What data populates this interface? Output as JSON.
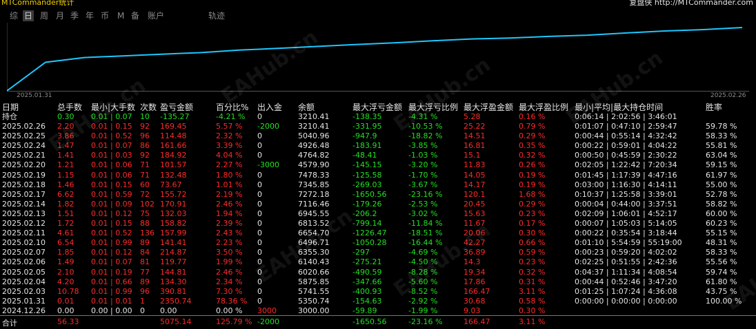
{
  "window": {
    "title": "MTCommander统计",
    "brand_cn": "复盘侠",
    "brand_url": "http://MTCommander.com"
  },
  "tabs": [
    "综",
    "日",
    "周",
    "月",
    "季",
    "年",
    "币",
    "M",
    "备",
    "账户",
    "轨迹"
  ],
  "active_tab": "日",
  "chart": {
    "start_label": "2025.01.31",
    "end_label": "2025.02.26",
    "line_color": "#1ec8ff"
  },
  "chart_data": {
    "type": "line",
    "x": [
      "2024.12.26",
      "2025.01.31",
      "2025.02.03",
      "2025.02.04",
      "2025.02.05",
      "2025.02.06",
      "2025.02.07",
      "2025.02.10",
      "2025.02.11",
      "2025.02.12",
      "2025.02.13",
      "2025.02.14",
      "2025.02.17",
      "2025.02.18",
      "2025.02.19",
      "2025.02.20",
      "2025.02.21",
      "2025.02.24",
      "2025.02.25",
      "2025.02.26"
    ],
    "values": [
      3000.0,
      5350.74,
      5741.55,
      5875.85,
      6020.66,
      6140.43,
      6355.3,
      6496.71,
      6654.7,
      6813.52,
      6945.55,
      7116.46,
      7272.18,
      7345.85,
      7478.33,
      4579.9,
      4764.82,
      4926.48,
      5040.96,
      3210.41
    ],
    "title": "",
    "xlabel": "",
    "ylabel": ""
  },
  "table": {
    "headers": [
      "日期",
      "总手数",
      "最小|大手数",
      "次数",
      "盈亏金额",
      "百分比%",
      "出入金",
      "余额",
      "最大浮亏金额",
      "最大浮亏比例",
      "最大浮盈金额",
      "最大浮盈比例",
      "最小|平均|最大持仓时间",
      "胜率"
    ],
    "position_row": [
      "持仓",
      "0.30",
      "0.01 | 0.07",
      "10",
      "-135.27",
      "-4.21 %",
      "0",
      "3210.41",
      "-138.35",
      "-4.31 %",
      "5.28",
      "0.16 %",
      "0:06:14 | 2:02:56 | 3:46:01",
      ""
    ],
    "rows": [
      [
        "2025.02.26",
        "2.20",
        "0.01 | 0.15",
        "92",
        "169.45",
        "5.57 %",
        "-2000",
        "3210.41",
        "-331.95",
        "-10.53 %",
        "25.22",
        "0.79 %",
        "0:01:07 | 0:47:10 | 2:59:47",
        "59.78 %"
      ],
      [
        "2025.02.25",
        "3.86",
        "0.01 | 0.52",
        "96",
        "114.48",
        "2.32 %",
        "0",
        "5040.96",
        "-947.9",
        "-18.82 %",
        "14.51",
        "0.29 %",
        "0:00:44 | 0:55:14 | 4:32:42",
        "58.33 %"
      ],
      [
        "2025.02.24",
        "1.47",
        "0.01 | 0.07",
        "86",
        "161.66",
        "3.39 %",
        "0",
        "4926.48",
        "-183.91",
        "-3.85 %",
        "16.81",
        "0.35 %",
        "0:00:22 | 0:59:01 | 4:04:22",
        "55.81 %"
      ],
      [
        "2025.02.21",
        "1.41",
        "0.01 | 0.03",
        "92",
        "184.92",
        "4.04 %",
        "0",
        "4764.82",
        "-48.41",
        "-1.03 %",
        "15.1",
        "0.32 %",
        "0:00:50 | 0:45:59 | 2:30:22",
        "63.04 %"
      ],
      [
        "2025.02.20",
        "1.21",
        "0.01 | 0.06",
        "71",
        "101.57",
        "2.27 %",
        "-3000",
        "4579.90",
        "-145.15",
        "-3.20 %",
        "11.83",
        "0.26 %",
        "0:02:05 | 1:22:42 | 7:20:34",
        "59.15 %"
      ],
      [
        "2025.02.19",
        "1.15",
        "0.01 | 0.06",
        "71",
        "132.48",
        "1.80 %",
        "0",
        "7478.33",
        "-125.58",
        "-1.70 %",
        "14.05",
        "0.19 %",
        "0:01:45 | 1:17:39 | 4:47:16",
        "61.97 %"
      ],
      [
        "2025.02.18",
        "1.46",
        "0.01 | 0.15",
        "60",
        "73.67",
        "1.01 %",
        "0",
        "7345.85",
        "-269.03",
        "-3.67 %",
        "14.17",
        "0.19 %",
        "0:03:00 | 1:16:30 | 4:14:11",
        "55.00 %"
      ],
      [
        "2025.02.17",
        "6.62",
        "0.01 | 0.59",
        "72",
        "155.72",
        "2.19 %",
        "0",
        "7272.18",
        "-1650.56",
        "-23.16 %",
        "120.1",
        "1.68 %",
        "0:10:37 | 1:25:58 | 3:39:01",
        "52.78 %"
      ],
      [
        "2025.02.14",
        "1.82",
        "0.01 | 0.09",
        "102",
        "170.91",
        "2.46 %",
        "0",
        "7116.46",
        "-179.26",
        "-2.53 %",
        "20.45",
        "0.29 %",
        "0:00:04 | 0:44:00 | 3:37:51",
        "58.82 %"
      ],
      [
        "2025.02.13",
        "1.51",
        "0.01 | 0.12",
        "75",
        "132.03",
        "1.94 %",
        "0",
        "6945.55",
        "-206.2",
        "-3.02 %",
        "15.63",
        "0.23 %",
        "0:02:09 | 1:06:01 | 4:52:17",
        "60.00 %"
      ],
      [
        "2025.02.12",
        "1.72",
        "0.01 | 0.15",
        "88",
        "158.82",
        "2.39 %",
        "0",
        "6813.52",
        "-799.14",
        "-11.84 %",
        "11.67",
        "0.17 %",
        "0:00:07 | 1:05:03 | 5:14:05",
        "60.23 %"
      ],
      [
        "2025.02.11",
        "4.61",
        "0.01 | 0.52",
        "136",
        "157.99",
        "2.43 %",
        "0",
        "6654.70",
        "-1226.47",
        "-18.51 %",
        "20.06",
        "0.30 %",
        "0:00:22 | 0:35:54 | 3:18:44",
        "55.15 %"
      ],
      [
        "2025.02.10",
        "6.54",
        "0.01 | 0.99",
        "89",
        "141.41",
        "2.23 %",
        "0",
        "6496.71",
        "-1050.28",
        "-16.44 %",
        "42.27",
        "0.66 %",
        "0:01:10 | 5:54:59 | 55:19:00",
        "48.31 %"
      ],
      [
        "2025.02.07",
        "1.85",
        "0.01 | 0.12",
        "84",
        "214.87",
        "3.50 %",
        "0",
        "6355.30",
        "-297",
        "-4.69 %",
        "36.89",
        "0.59 %",
        "0:00:23 | 0:59:20 | 4:02:02",
        "58.33 %"
      ],
      [
        "2025.02.06",
        "1.49",
        "0.01 | 0.07",
        "81",
        "119.77",
        "1.99 %",
        "0",
        "6140.43",
        "-275.21",
        "-4.50 %",
        "14.3",
        "0.23 %",
        "0:02:25 | 0:51:55 | 2:42:36",
        "55.56 %"
      ],
      [
        "2025.02.05",
        "2.10",
        "0.01 | 0.19",
        "77",
        "144.81",
        "2.46 %",
        "0",
        "6020.66",
        "-490.59",
        "-8.28 %",
        "19.34",
        "0.32 %",
        "0:04:37 | 1:11:34 | 4:08:54",
        "59.74 %"
      ],
      [
        "2025.02.04",
        "4.20",
        "0.01 | 0.66",
        "89",
        "134.30",
        "2.34 %",
        "0",
        "5875.85",
        "-347.66",
        "-5.60 %",
        "17.86",
        "0.31 %",
        "0:00:44 | 0:52:46 | 3:47:20",
        "61.80 %"
      ],
      [
        "2025.02.03",
        "10.78",
        "0.01 | 0.99",
        "96",
        "390.81",
        "7.30 %",
        "0",
        "5741.55",
        "-400.93",
        "-8.52 %",
        "166.47",
        "3.11 %",
        "0:01:25 | 1:07:24 | 4:36:08",
        "43.75 %"
      ],
      [
        "2025.01.31",
        "0.01",
        "0.01 | 0.01",
        "1",
        "2350.74",
        "78.36 %",
        "0",
        "5350.74",
        "-154.63",
        "-2.92 %",
        "30.68",
        "0.58 %",
        "0:00:00 | 0:00:00 | 0:00:00",
        "100.00 %"
      ],
      [
        "2024.12.26",
        "0.00",
        "0.00 | 0.00",
        "0",
        "0.00",
        "0.00 %",
        "3000",
        "3000.00",
        "-59.89",
        "-1.99 %",
        "9.03",
        "0.30 %",
        "",
        ""
      ]
    ],
    "summary": [
      "合计",
      "56.33",
      "",
      "",
      "5075.14",
      "125.79 %",
      "-2000",
      "",
      "-1650.56",
      "-23.16 %",
      "166.47",
      "3.11 %",
      "",
      ""
    ]
  },
  "watermark": "EAHub.cn",
  "colors": {
    "positive": "#ff2a2a",
    "negative": "#22e022",
    "accent": "#f0d000",
    "line": "#1ec8ff"
  }
}
